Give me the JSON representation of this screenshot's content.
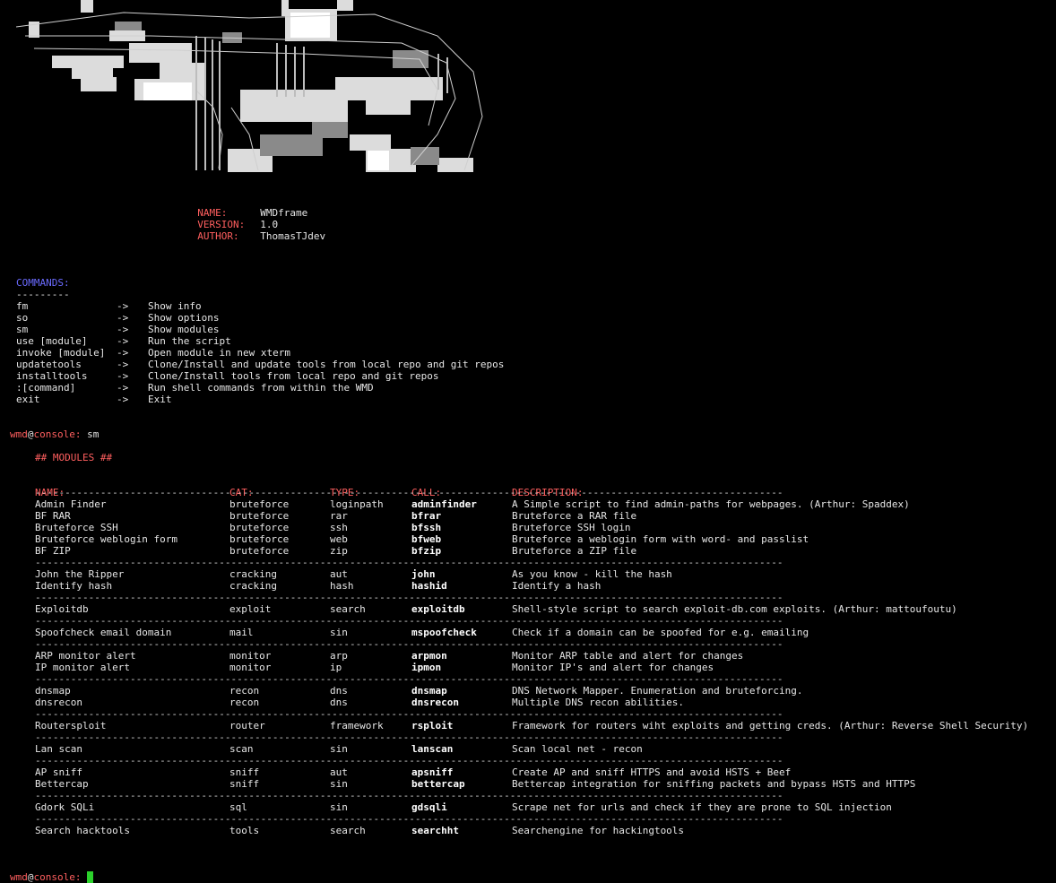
{
  "info": {
    "name_label": "NAME:",
    "name_value": "WMDframe",
    "version_label": "VERSION:",
    "version_value": "1.0",
    "author_label": "AUTHOR:",
    "author_value": "ThomasTJdev"
  },
  "commands": {
    "title": "COMMANDS:",
    "underline": "---------",
    "arrow": "->",
    "items": [
      {
        "cmd": "fm",
        "desc": "Show info"
      },
      {
        "cmd": "so",
        "desc": "Show options"
      },
      {
        "cmd": "sm",
        "desc": "Show modules"
      },
      {
        "cmd": "use [module]",
        "desc": "Run the script"
      },
      {
        "cmd": "invoke [module]",
        "desc": "Open module in new xterm"
      },
      {
        "cmd": "updatetools",
        "desc": "Clone/Install and update tools from local repo and git repos"
      },
      {
        "cmd": "installtools",
        "desc": "Clone/Install tools from local repo and git repos"
      },
      {
        "cmd": ":[command]",
        "desc": "Run shell commands from within the WMD"
      },
      {
        "cmd": "exit",
        "desc": "Exit"
      }
    ]
  },
  "prompt": {
    "user": "wmd",
    "at": "@",
    "host": "console:",
    "entered": "sm",
    "current": ""
  },
  "modules": {
    "title": "## MODULES ##",
    "headers": {
      "name": "NAME:",
      "cat": "CAT:",
      "type": "TYPE:",
      "call": "CALL:",
      "desc": "DESCRIPTION:"
    },
    "separator": "------------------------------------------------------------------------------------------------------------------------------",
    "groups": [
      [
        {
          "name": "Admin Finder",
          "cat": "bruteforce",
          "type": "loginpath",
          "call": "adminfinder",
          "desc": "A Simple script to find admin-paths for webpages. (Arthur: Spaddex)"
        },
        {
          "name": "BF RAR",
          "cat": "bruteforce",
          "type": "rar",
          "call": "bfrar",
          "desc": "Bruteforce a RAR file"
        },
        {
          "name": "Bruteforce SSH",
          "cat": "bruteforce",
          "type": "ssh",
          "call": "bfssh",
          "desc": "Bruteforce SSH login"
        },
        {
          "name": "Bruteforce weblogin form",
          "cat": "bruteforce",
          "type": "web",
          "call": "bfweb",
          "desc": "Bruteforce a weblogin form with word- and passlist"
        },
        {
          "name": "BF ZIP",
          "cat": "bruteforce",
          "type": "zip",
          "call": "bfzip",
          "desc": "Bruteforce a ZIP file"
        }
      ],
      [
        {
          "name": "John the Ripper",
          "cat": "cracking",
          "type": "aut",
          "call": "john",
          "desc": "As you know - kill the hash"
        },
        {
          "name": "Identify hash",
          "cat": "cracking",
          "type": "hash",
          "call": "hashid",
          "desc": "Identify a hash"
        }
      ],
      [
        {
          "name": "Exploitdb",
          "cat": "exploit",
          "type": "search",
          "call": "exploitdb",
          "desc": "Shell-style script to search exploit-db.com exploits. (Arthur: mattoufoutu)"
        }
      ],
      [
        {
          "name": "Spoofcheck email domain",
          "cat": "mail",
          "type": "sin",
          "call": "mspoofcheck",
          "desc": "Check if a domain can be spoofed for e.g. emailing"
        }
      ],
      [
        {
          "name": "ARP monitor alert",
          "cat": "monitor",
          "type": "arp",
          "call": "arpmon",
          "desc": "Monitor ARP table and alert for changes"
        },
        {
          "name": "IP monitor alert",
          "cat": "monitor",
          "type": "ip",
          "call": "ipmon",
          "desc": "Monitor IP's and alert for changes"
        }
      ],
      [
        {
          "name": "dnsmap",
          "cat": "recon",
          "type": "dns",
          "call": "dnsmap",
          "desc": "DNS Network Mapper. Enumeration and bruteforcing."
        },
        {
          "name": "dnsrecon",
          "cat": "recon",
          "type": "dns",
          "call": "dnsrecon",
          "desc": "Multiple DNS recon abilities."
        }
      ],
      [
        {
          "name": "Routersploit",
          "cat": "router",
          "type": "framework",
          "call": "rsploit",
          "desc": "Framework for routers wiht exploits and getting creds. (Arthur: Reverse Shell Security)"
        }
      ],
      [
        {
          "name": "Lan scan",
          "cat": "scan",
          "type": "sin",
          "call": "lanscan",
          "desc": "Scan local net - recon"
        }
      ],
      [
        {
          "name": "AP sniff",
          "cat": "sniff",
          "type": "aut",
          "call": "apsniff",
          "desc": "Create AP and sniff HTTPS and avoid HSTS + Beef"
        },
        {
          "name": "Bettercap",
          "cat": "sniff",
          "type": "sin",
          "call": "bettercap",
          "desc": "Bettercap integration for sniffing packets and bypass HSTS and HTTPS"
        }
      ],
      [
        {
          "name": "Gdork SQLi",
          "cat": "sql",
          "type": "sin",
          "call": "gdsqli",
          "desc": "Scrape net for urls and check if they are prone to SQL injection"
        }
      ],
      [
        {
          "name": "Search hacktools",
          "cat": "tools",
          "type": "search",
          "call": "searchht",
          "desc": "Searchengine for hackingtools"
        }
      ]
    ]
  },
  "colors": {
    "label_red": "#ff5f5f",
    "title_blue": "#6b6bff",
    "cursor_green": "#2bd12b",
    "background": "#000000"
  }
}
